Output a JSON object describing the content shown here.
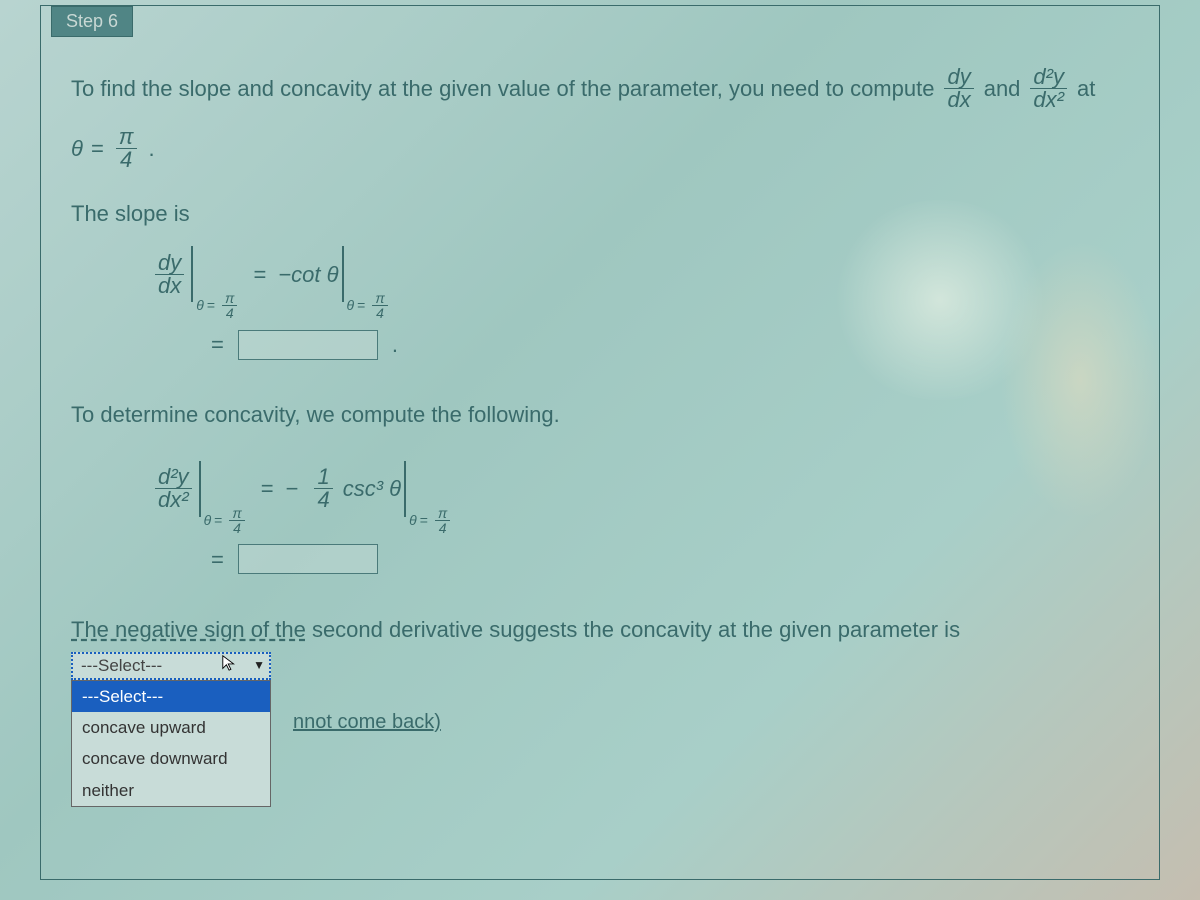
{
  "header": {
    "step": "Step 6"
  },
  "intro": {
    "part1": "To find the slope and concavity at the given value of the parameter, you need to compute",
    "and": "and",
    "at": "at"
  },
  "param": {
    "theta": "θ",
    "equals": "=",
    "pi": "π",
    "four": "4",
    "period": "."
  },
  "slope": {
    "label": "The slope is",
    "dy": "dy",
    "dx": "dx",
    "equals1": "=",
    "negcot": "−cot θ",
    "equals2": "="
  },
  "concavity": {
    "intro": "To determine concavity, we compute the following.",
    "d2y": "d²y",
    "dx2": "dx²",
    "equals1": "=",
    "neg": "−",
    "one": "1",
    "four": "4",
    "csc3": "csc³ θ",
    "equals2": "="
  },
  "conclusion": {
    "prefix": "The negative sign of the",
    "rest": " second derivative suggests the concavity at the given parameter is"
  },
  "dropdown": {
    "placeholder": "---Select---",
    "options": [
      "---Select---",
      "concave upward",
      "concave downward",
      "neither"
    ],
    "selectedIndex": 0
  },
  "occluded": {
    "text": "nnot come back)"
  }
}
